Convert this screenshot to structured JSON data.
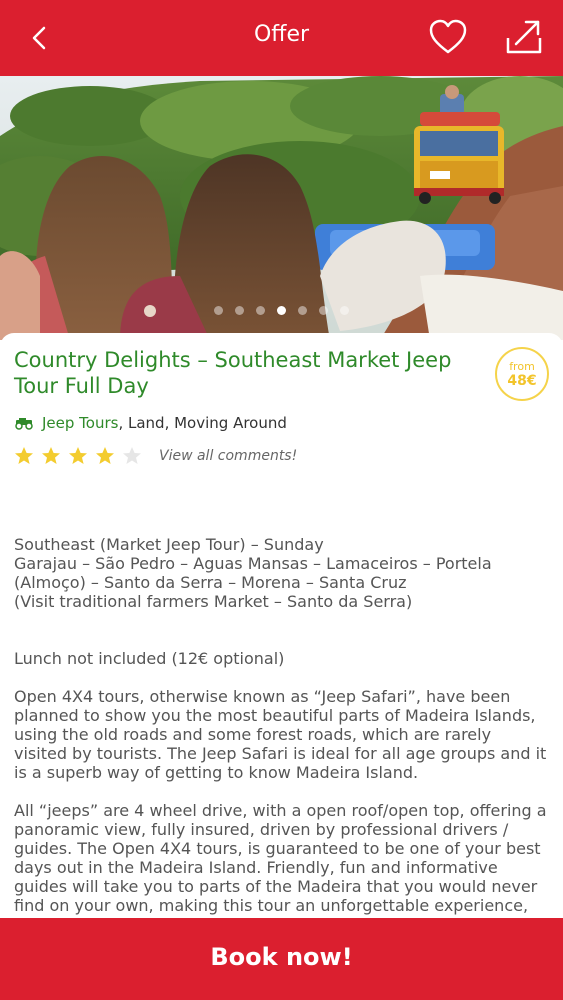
{
  "header": {
    "title": "Offer",
    "back_icon": "chevron-left-icon",
    "favorite_icon": "heart-icon",
    "share_icon": "share-icon",
    "color": "#db1f2f"
  },
  "gallery": {
    "dot_count": 7,
    "active_index": 3
  },
  "tour": {
    "title": "Country Delights – Southeast Market Jeep Tour Full Day",
    "price_from_label": "from",
    "price": "48€",
    "category_link": "Jeep Tours",
    "category_rest": ", Land, Moving Around",
    "rating": 4,
    "rating_max": 5,
    "comments_link": "View all comments!"
  },
  "description": {
    "p1_lines": [
      "Southeast (Market Jeep Tour) – Sunday",
      "Garajau – São Pedro – Aguas Mansas – Lamaceiros – Portela (Almoço) – Santo da Serra – Morena – Santa Cruz",
      "(Visit traditional farmers Market – Santo da Serra)"
    ],
    "p2": "Lunch not included (12€ optional)",
    "p3": "Open 4X4 tours, otherwise known as “Jeep Safari”, have been planned to show you the most beautiful parts of Madeira Islands, using the old roads and some forest roads, which are rarely visited by tourists. The Jeep Safari is ideal for all age groups and it is a superb way of getting to know Madeira Island.",
    "p4": "All “jeeps” are 4 wheel drive, with a open roof/open top, offering a panoramic view, fully insured, driven by professional drivers / guides. The Open 4X4 tours, is guaranteed to be one of your best days out in the Madeira Island. Friendly, fun and informative guides will take you to parts of the Madeira that you would never find on your own, making this tour an unforgettable experience, leaving"
  },
  "footer": {
    "book_label": "Book now!"
  }
}
